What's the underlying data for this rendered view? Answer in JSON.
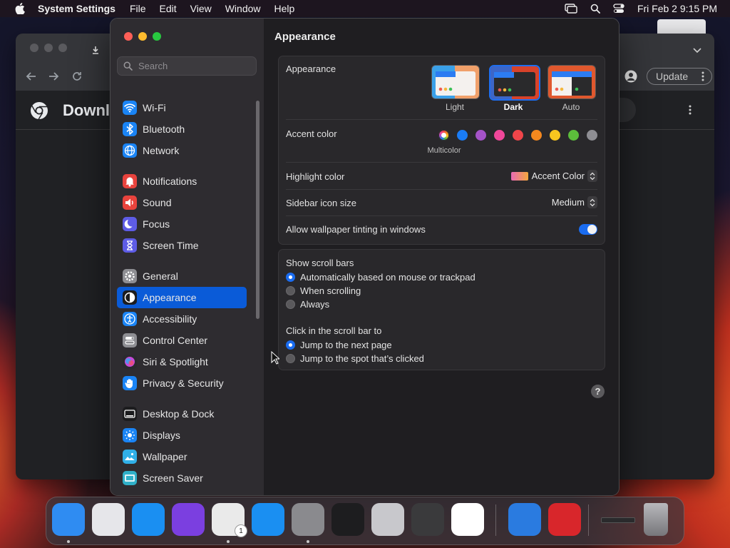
{
  "menubar": {
    "app_name": "System Settings",
    "menus": [
      "File",
      "Edit",
      "View",
      "Window",
      "Help"
    ],
    "clock": "Fri Feb 2  9:15 PM"
  },
  "browser": {
    "page_title": "Downl",
    "update_label": "Update"
  },
  "settings": {
    "search_placeholder": "Search",
    "sidebar_groups": [
      [
        {
          "label": "Wi-Fi",
          "icon": "wifi-icon",
          "color": "#1a84f5"
        },
        {
          "label": "Bluetooth",
          "icon": "bluetooth-icon",
          "color": "#1a84f5"
        },
        {
          "label": "Network",
          "icon": "globe-icon",
          "color": "#1a84f5"
        }
      ],
      [
        {
          "label": "Notifications",
          "icon": "bell-icon",
          "color": "#e8433d"
        },
        {
          "label": "Sound",
          "icon": "speaker-icon",
          "color": "#e8433d"
        },
        {
          "label": "Focus",
          "icon": "moon-icon",
          "color": "#5e5ce6"
        },
        {
          "label": "Screen Time",
          "icon": "hourglass-icon",
          "color": "#5e5ce6"
        }
      ],
      [
        {
          "label": "General",
          "icon": "gear-icon",
          "color": "#8e8e93"
        },
        {
          "label": "Appearance",
          "icon": "appearance-icon",
          "color": "#1c1c1e",
          "selected": true
        },
        {
          "label": "Accessibility",
          "icon": "accessibility-icon",
          "color": "#1a84f5"
        },
        {
          "label": "Control Center",
          "icon": "control-center-icon",
          "color": "#8e8e93"
        },
        {
          "label": "Siri & Spotlight",
          "icon": "siri-icon",
          "color": "#2a2a2e"
        },
        {
          "label": "Privacy & Security",
          "icon": "hand-icon",
          "color": "#1a84f5"
        }
      ],
      [
        {
          "label": "Desktop & Dock",
          "icon": "dock-icon",
          "color": "#1c1c1e"
        },
        {
          "label": "Displays",
          "icon": "sun-icon",
          "color": "#1a84f5"
        },
        {
          "label": "Wallpaper",
          "icon": "wallpaper-icon",
          "color": "#30b0e8"
        },
        {
          "label": "Screen Saver",
          "icon": "screensaver-icon",
          "color": "#30b0c8"
        }
      ]
    ],
    "page_title": "Appearance",
    "appearance": {
      "label": "Appearance",
      "options": [
        {
          "label": "Light",
          "selected": false
        },
        {
          "label": "Dark",
          "selected": true
        },
        {
          "label": "Auto",
          "selected": false
        }
      ]
    },
    "accent": {
      "label": "Accent color",
      "selected_caption": "Multicolor",
      "colors": [
        "multicolor",
        "#1a7cf5",
        "#a553c8",
        "#f0479a",
        "#f0454a",
        "#f5881e",
        "#f8c61f",
        "#5cbd3b",
        "#8e8e93"
      ]
    },
    "highlight": {
      "label": "Highlight color",
      "value": "Accent Color"
    },
    "sidebar_icon_size": {
      "label": "Sidebar icon size",
      "value": "Medium"
    },
    "tinting": {
      "label": "Allow wallpaper tinting in windows",
      "on": true
    },
    "scroll_bars": {
      "label": "Show scroll bars",
      "options": [
        {
          "label": "Automatically based on mouse or trackpad",
          "selected": true
        },
        {
          "label": "When scrolling",
          "selected": false
        },
        {
          "label": "Always",
          "selected": false
        }
      ]
    },
    "click_scroll": {
      "label": "Click in the scroll bar to",
      "options": [
        {
          "label": "Jump to the next page",
          "selected": true
        },
        {
          "label": "Jump to the spot that’s clicked",
          "selected": false
        }
      ]
    },
    "help_label": "?"
  },
  "dock": {
    "apps": [
      {
        "name": "finder-icon",
        "color": "#2f8cf2",
        "running": true
      },
      {
        "name": "launchpad-icon",
        "color": "#e6e6ea",
        "running": false
      },
      {
        "name": "safari-icon",
        "color": "#1a8ff2",
        "running": false
      },
      {
        "name": "firefox-icon",
        "color": "#7b3fe0",
        "running": false
      },
      {
        "name": "chrome-icon",
        "color": "#eaeaea",
        "running": true,
        "badge": "1"
      },
      {
        "name": "app-store-icon",
        "color": "#1a8ff2",
        "running": false
      },
      {
        "name": "system-settings-icon",
        "color": "#8a8a8e",
        "running": true
      },
      {
        "name": "terminal-icon",
        "color": "#1d1d1f",
        "running": false
      },
      {
        "name": "disk-utility-icon",
        "color": "#c8c8cc",
        "running": false
      },
      {
        "name": "garageband-icon",
        "color": "#3a3a3c",
        "running": false
      },
      {
        "name": "vscode-icon",
        "color": "#ffffff",
        "running": false
      },
      {
        "name": "weather-icon",
        "color": "#2a7be0",
        "running": false
      },
      {
        "name": "photo-booth-icon",
        "color": "#d8262b",
        "running": false
      },
      {
        "name": "downloads-stack-icon",
        "color": "#2a2a2c",
        "running": false
      },
      {
        "name": "trash-icon",
        "color": "#8e8e93",
        "running": false
      }
    ]
  }
}
